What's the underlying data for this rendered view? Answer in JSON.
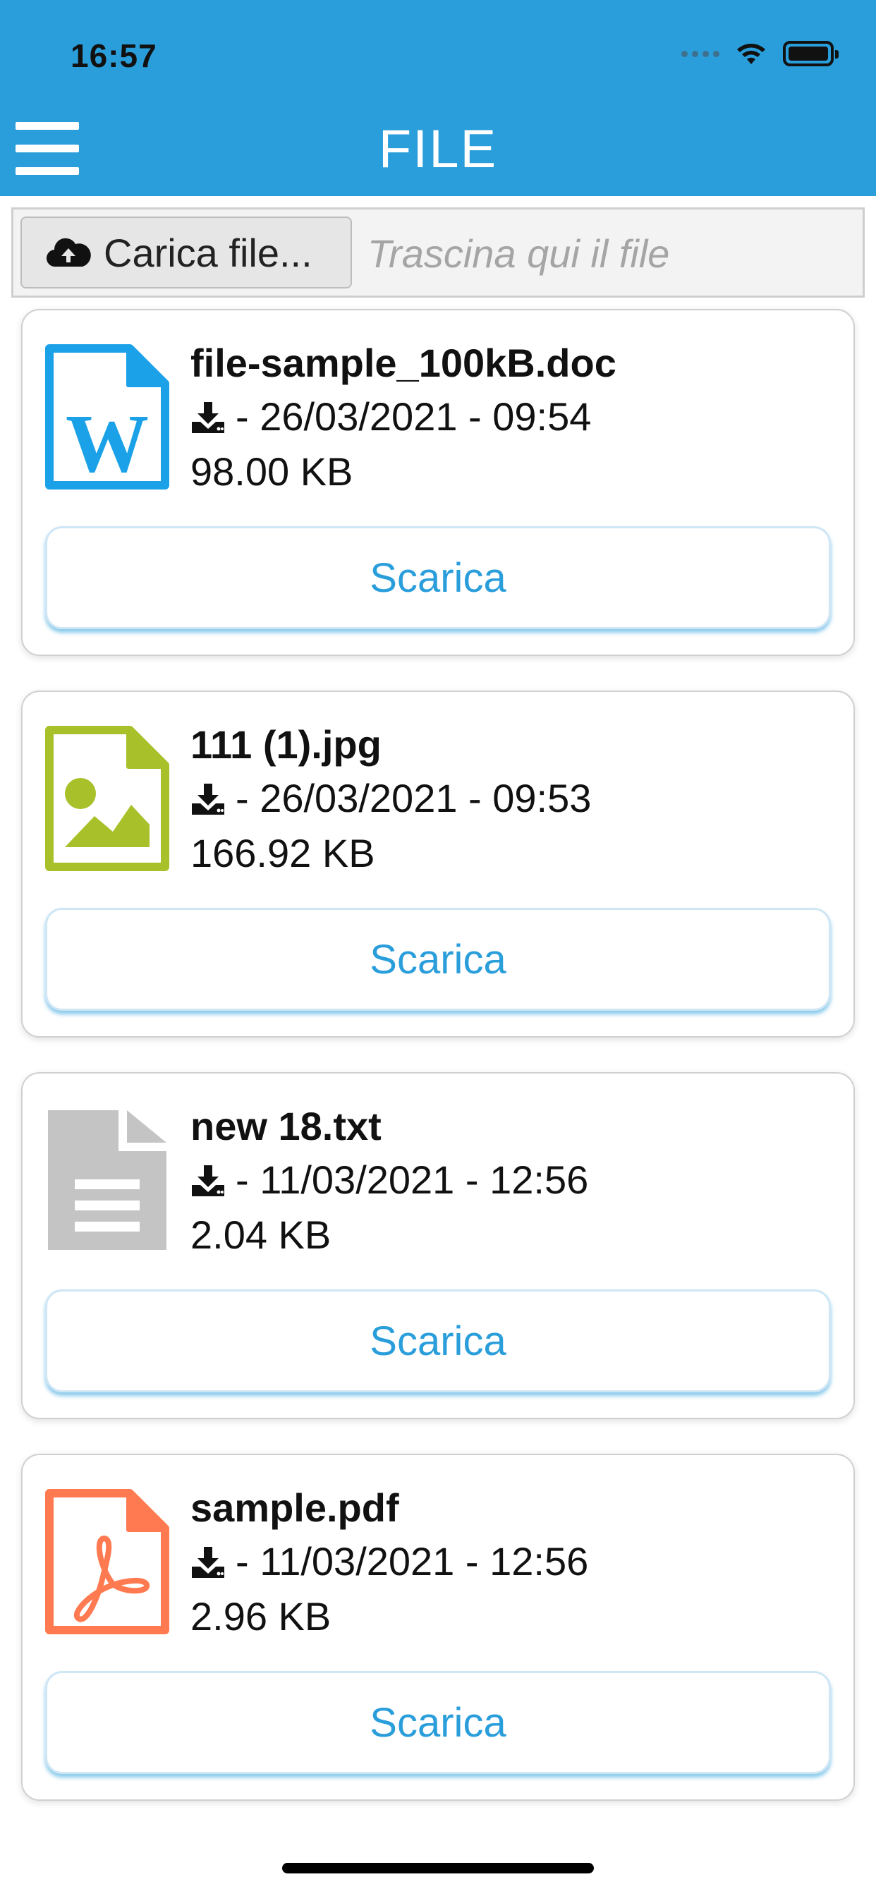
{
  "status_bar": {
    "time": "16:57"
  },
  "header": {
    "title": "FILE"
  },
  "upload": {
    "button_label": "Carica file...",
    "drop_placeholder": "Trascina qui il file"
  },
  "files": [
    {
      "name": "file-sample_100kB.doc",
      "meta": "- 26/03/2021 - 09:54",
      "size": "98.00 KB",
      "type": "word",
      "icon_color": "#1aa1e8",
      "action": "Scarica"
    },
    {
      "name": "111 (1).jpg",
      "meta": "- 26/03/2021 - 09:53",
      "size": "166.92 KB",
      "type": "image",
      "icon_color": "#a8c12a",
      "action": "Scarica"
    },
    {
      "name": "new 18.txt",
      "meta": "- 11/03/2021 - 12:56",
      "size": "2.04 KB",
      "type": "text",
      "icon_color": "#c4c4c4",
      "action": "Scarica"
    },
    {
      "name": "sample.pdf",
      "meta": "- 11/03/2021 - 12:56",
      "size": "2.96 KB",
      "type": "pdf",
      "icon_color": "#ff7a50",
      "action": "Scarica"
    }
  ],
  "colors": {
    "header_bg": "#2a9edb",
    "accent": "#2a9edb"
  }
}
